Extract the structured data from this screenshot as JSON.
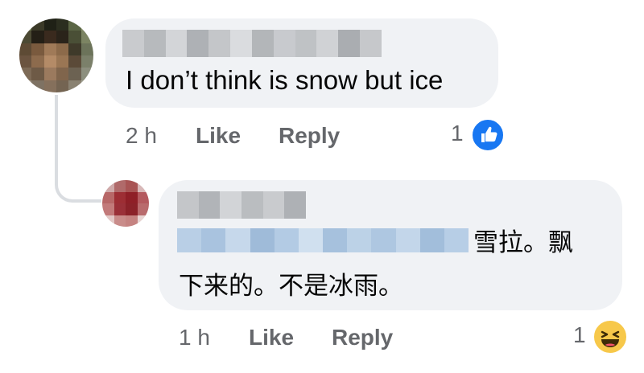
{
  "comments": [
    {
      "text": "I don’t think is snow but ice",
      "time": "2 h",
      "like_label": "Like",
      "reply_label": "Reply",
      "reaction_count": "1",
      "reaction_icon": "like-icon"
    },
    {
      "text_line1": "雪拉。飘",
      "text_line2": "下来的。不是冰雨。",
      "time": "1 h",
      "like_label": "Like",
      "reply_label": "Reply",
      "reaction_count": "1",
      "reaction_icon": "haha-icon"
    }
  ],
  "colors": {
    "bubble": "#f0f2f5",
    "meta_text": "#65676b",
    "like_blue": "#1877f2",
    "haha_yellow": "#f7c84a"
  }
}
